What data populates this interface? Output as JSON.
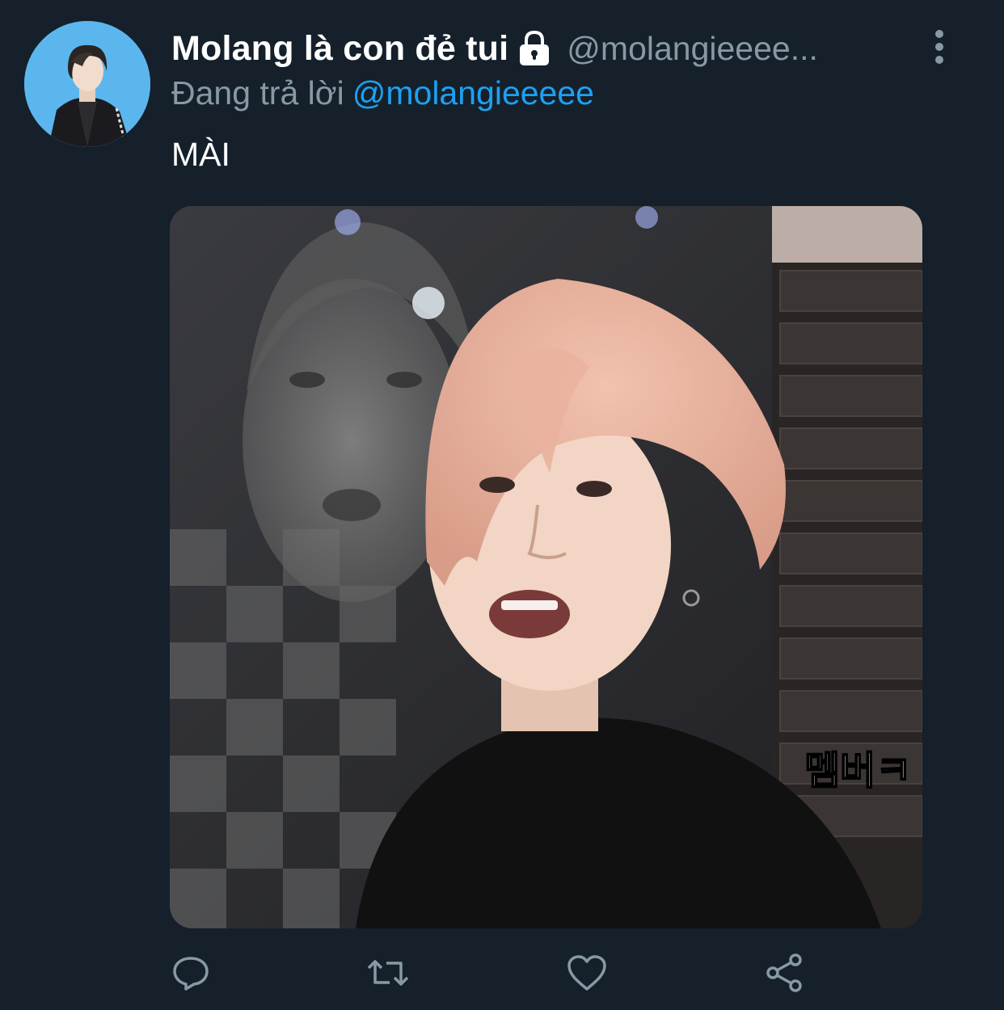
{
  "tweet": {
    "display_name": "Molang là con đẻ tui",
    "handle": "@molangieeee...",
    "reply_prefix": "Đang trả lời",
    "reply_to": "@molangieeeee",
    "text": "MÀI",
    "media_caption": "멤버ㅋ"
  },
  "icons": {
    "lock": "lock-icon",
    "more": "more-vertical-icon",
    "reply": "reply-icon",
    "retweet": "retweet-icon",
    "like": "heart-icon",
    "share": "share-icon"
  },
  "colors": {
    "background": "#15202b",
    "secondary_text": "#8899a6",
    "mention": "#1da1f2",
    "avatar_bg": "#5cb6ee"
  }
}
